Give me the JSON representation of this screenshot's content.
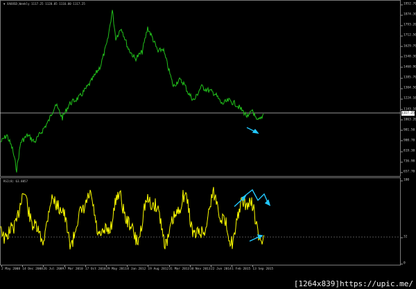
{
  "header": {
    "title": "▼ XAUUSD,Weekly  1117.25  1120.05  1116.00  1117.25",
    "rsi_title": "RSI(8) 63.8857"
  },
  "price_axis": {
    "ticks": [
      "1952.70",
      "1874.30",
      "1793.20",
      "1712.50",
      "1629.70",
      "1548.30",
      "1460.90",
      "1385.70",
      "1304.50",
      "1224.10",
      "1143.10",
      "1063.20",
      "981.50",
      "900.70",
      "819.30",
      "736.90",
      "657.70"
    ],
    "current_price": "1117.25"
  },
  "rsi_axis": {
    "ticks": [
      "100",
      "32",
      "0"
    ]
  },
  "x_axis": {
    "labels": [
      "2 May 2008",
      "14 Dec 2008",
      "26 Jul 2009",
      "7 Mar 2010",
      "17 Oct 2010",
      "29 May 2011",
      "8 Jan 2012",
      "19 Aug 2012",
      "31 Mar 2013",
      "10 Nov 2013",
      "22 Jun 2014",
      "1 Feb 2015",
      "13 Sep 2015"
    ]
  },
  "watermark": "[1264x839]https://upic.me/",
  "colors": {
    "background": "#000000",
    "price_line": "#22c21c",
    "rsi_line": "#ffff00",
    "annotation_arrow": "#22c8ff",
    "current_price_line": "#c8c8c8"
  }
}
